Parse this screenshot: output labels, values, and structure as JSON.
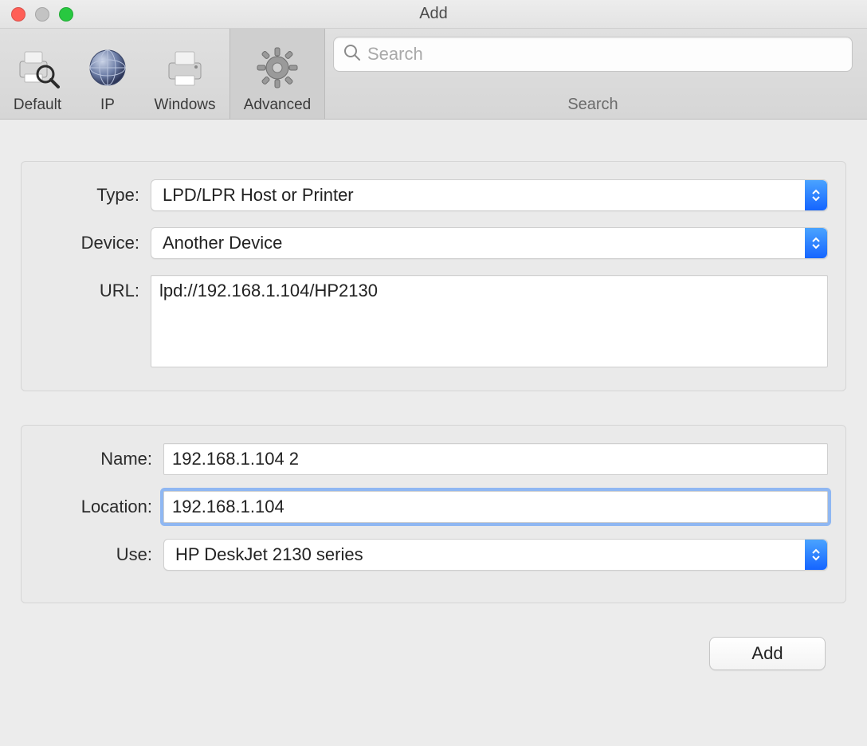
{
  "window": {
    "title": "Add"
  },
  "toolbar": {
    "items": [
      {
        "label": "Default"
      },
      {
        "label": "IP"
      },
      {
        "label": "Windows"
      },
      {
        "label": "Advanced"
      }
    ],
    "selected_index": 3,
    "search": {
      "placeholder": "Search",
      "label": "Search"
    }
  },
  "form": {
    "type": {
      "label": "Type:",
      "value": "LPD/LPR Host or Printer"
    },
    "device": {
      "label": "Device:",
      "value": "Another Device"
    },
    "url": {
      "label": "URL:",
      "value": "lpd://192.168.1.104/HP2130"
    },
    "name": {
      "label": "Name:",
      "value": "192.168.1.104 2"
    },
    "location": {
      "label": "Location:",
      "value": "192.168.1.104"
    },
    "use": {
      "label": "Use:",
      "value": "HP DeskJet 2130 series"
    },
    "add_button": "Add"
  }
}
